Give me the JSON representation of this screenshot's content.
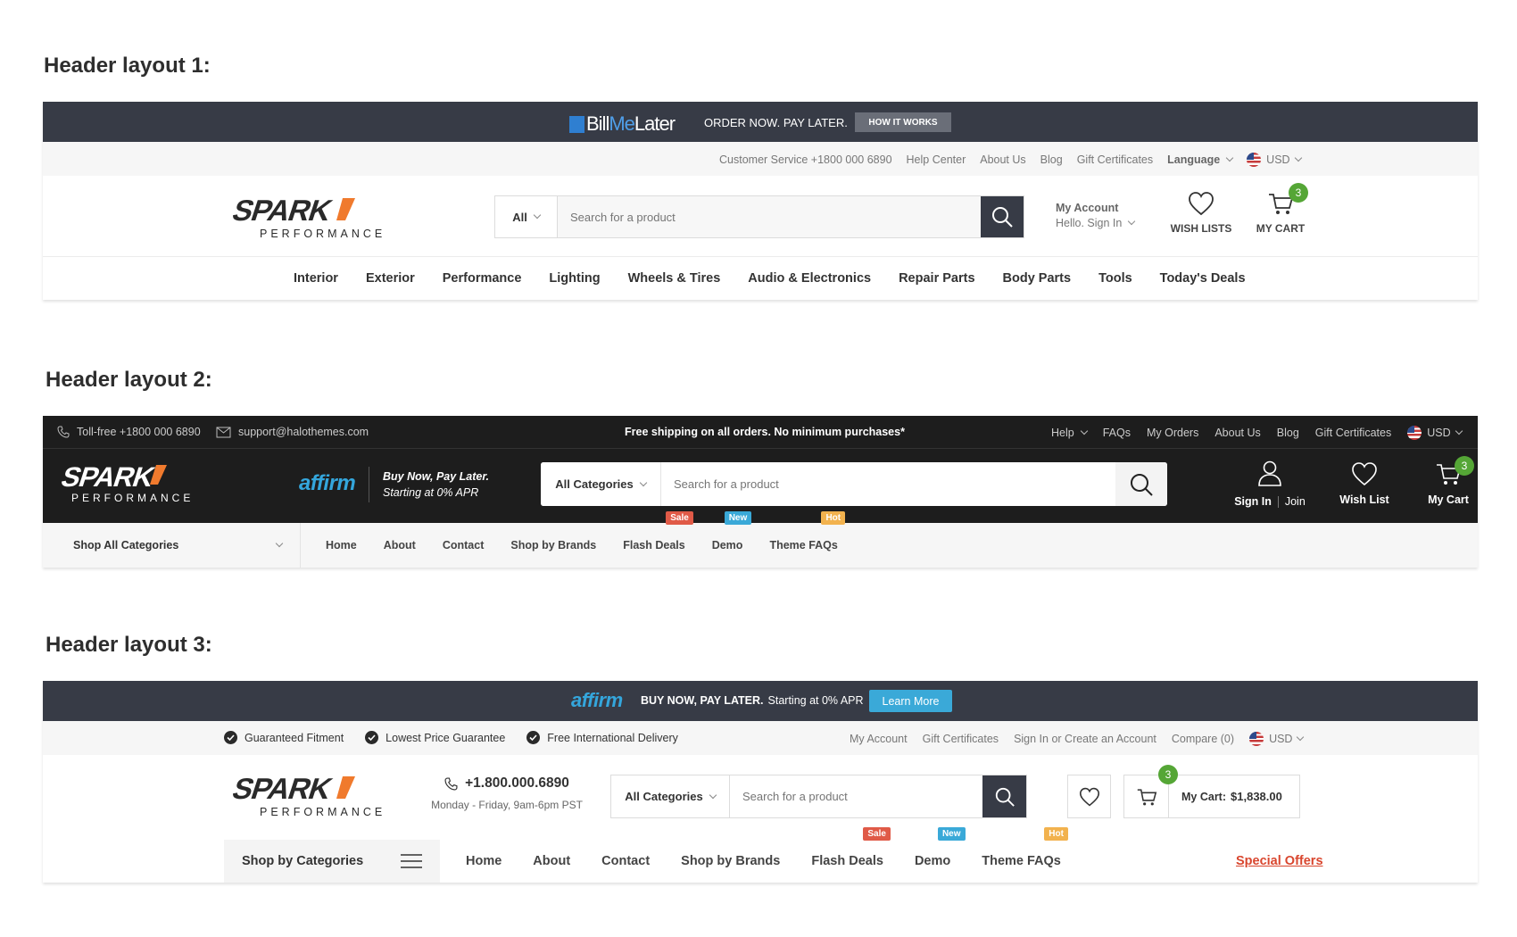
{
  "layout1": {
    "title": "Header layout 1:",
    "promo": {
      "brand_bill": "Bill",
      "brand_me": "Me",
      "brand_later": "Later",
      "text": "ORDER NOW. PAY LATER.",
      "button": "HOW IT WORKS"
    },
    "toplinks": [
      "Customer Service +1800 000 6890",
      "Help Center",
      "About Us",
      "Blog",
      "Gift Certificates"
    ],
    "language": "Language",
    "currency": "USD",
    "logo_word": "SPARK",
    "logo_sub": "PERFORMANCE",
    "search": {
      "category": "All",
      "placeholder": "Search for a product"
    },
    "account": {
      "title": "My Account",
      "sub": "Hello. Sign In"
    },
    "wishlist": "WISH LISTS",
    "cart": {
      "label": "MY CART",
      "count": "3"
    },
    "nav": [
      "Interior",
      "Exterior",
      "Performance",
      "Lighting",
      "Wheels & Tires",
      "Audio & Electronics",
      "Repair Parts",
      "Body Parts",
      "Tools",
      "Today's Deals"
    ]
  },
  "layout2": {
    "title": "Header layout 2:",
    "phone": "Toll-free +1800 000 6890",
    "email": "support@halothemes.com",
    "shipping": "Free shipping on all orders. No minimum purchases*",
    "toplinks": [
      "Help",
      "FAQs",
      "My Orders",
      "About Us",
      "Blog",
      "Gift Certificates"
    ],
    "currency": "USD",
    "logo_word": "SPARK",
    "logo_sub": "PERFORMANCE",
    "affirm": "affirm",
    "affirm_line1": "Buy Now, Pay Later.",
    "affirm_line2": "Starting at 0% APR",
    "search": {
      "category": "All Categories",
      "placeholder": "Search for a product"
    },
    "sign_in": "Sign In",
    "join": "Join",
    "wishlist": "Wish List",
    "cart": {
      "label": "My Cart",
      "count": "3"
    },
    "shop_all": "Shop All Categories",
    "nav": [
      "Home",
      "About",
      "Contact",
      "Shop by Brands",
      "Flash Deals",
      "Demo",
      "Theme FAQs"
    ],
    "tags": {
      "sale": "Sale",
      "new": "New",
      "hot": "Hot"
    }
  },
  "layout3": {
    "title": "Header layout 3:",
    "affirm": "affirm",
    "promo_bold": "BUY NOW, PAY LATER.",
    "promo_text": "Starting at 0% APR",
    "promo_button": "Learn More",
    "features": [
      "Guaranteed Fitment",
      "Lowest Price Guarantee",
      "Free International Delivery"
    ],
    "toplinks": [
      "My Account",
      "Gift Certificates",
      "Sign In or Create an Account",
      "Compare (0)"
    ],
    "currency": "USD",
    "logo_word": "SPARK",
    "logo_sub": "PERFORMANCE",
    "phone": "+1.800.000.6890",
    "hours": "Monday - Friday, 9am-6pm PST",
    "search": {
      "category": "All Categories",
      "placeholder": "Search for a product"
    },
    "cart": {
      "label": "My Cart:",
      "amount": "$1,838.00",
      "count": "3"
    },
    "shop_by": "Shop by Categories",
    "nav": [
      "Home",
      "About",
      "Contact",
      "Shop by Brands",
      "Flash Deals",
      "Demo",
      "Theme FAQs"
    ],
    "tags": {
      "sale": "Sale",
      "new": "New",
      "hot": "Hot"
    },
    "special": "Special Offers"
  },
  "colors": {
    "dark_slate": "#373b46",
    "near_black": "#1d1d1d",
    "accent_green": "#55a636",
    "affirm_blue": "#34a6dc",
    "special_red": "#d9462e",
    "orange": "#f07a2d"
  }
}
